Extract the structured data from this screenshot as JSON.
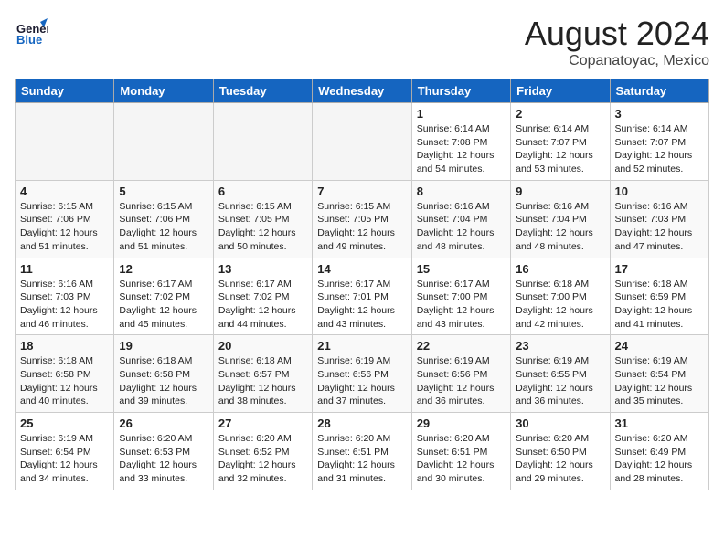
{
  "header": {
    "logo_line1": "General",
    "logo_line2": "Blue",
    "month_year": "August 2024",
    "location": "Copanatoyac, Mexico"
  },
  "weekdays": [
    "Sunday",
    "Monday",
    "Tuesday",
    "Wednesday",
    "Thursday",
    "Friday",
    "Saturday"
  ],
  "weeks": [
    [
      {
        "day": "",
        "info": ""
      },
      {
        "day": "",
        "info": ""
      },
      {
        "day": "",
        "info": ""
      },
      {
        "day": "",
        "info": ""
      },
      {
        "day": "1",
        "info": "Sunrise: 6:14 AM\nSunset: 7:08 PM\nDaylight: 12 hours\nand 54 minutes."
      },
      {
        "day": "2",
        "info": "Sunrise: 6:14 AM\nSunset: 7:07 PM\nDaylight: 12 hours\nand 53 minutes."
      },
      {
        "day": "3",
        "info": "Sunrise: 6:14 AM\nSunset: 7:07 PM\nDaylight: 12 hours\nand 52 minutes."
      }
    ],
    [
      {
        "day": "4",
        "info": "Sunrise: 6:15 AM\nSunset: 7:06 PM\nDaylight: 12 hours\nand 51 minutes."
      },
      {
        "day": "5",
        "info": "Sunrise: 6:15 AM\nSunset: 7:06 PM\nDaylight: 12 hours\nand 51 minutes."
      },
      {
        "day": "6",
        "info": "Sunrise: 6:15 AM\nSunset: 7:05 PM\nDaylight: 12 hours\nand 50 minutes."
      },
      {
        "day": "7",
        "info": "Sunrise: 6:15 AM\nSunset: 7:05 PM\nDaylight: 12 hours\nand 49 minutes."
      },
      {
        "day": "8",
        "info": "Sunrise: 6:16 AM\nSunset: 7:04 PM\nDaylight: 12 hours\nand 48 minutes."
      },
      {
        "day": "9",
        "info": "Sunrise: 6:16 AM\nSunset: 7:04 PM\nDaylight: 12 hours\nand 48 minutes."
      },
      {
        "day": "10",
        "info": "Sunrise: 6:16 AM\nSunset: 7:03 PM\nDaylight: 12 hours\nand 47 minutes."
      }
    ],
    [
      {
        "day": "11",
        "info": "Sunrise: 6:16 AM\nSunset: 7:03 PM\nDaylight: 12 hours\nand 46 minutes."
      },
      {
        "day": "12",
        "info": "Sunrise: 6:17 AM\nSunset: 7:02 PM\nDaylight: 12 hours\nand 45 minutes."
      },
      {
        "day": "13",
        "info": "Sunrise: 6:17 AM\nSunset: 7:02 PM\nDaylight: 12 hours\nand 44 minutes."
      },
      {
        "day": "14",
        "info": "Sunrise: 6:17 AM\nSunset: 7:01 PM\nDaylight: 12 hours\nand 43 minutes."
      },
      {
        "day": "15",
        "info": "Sunrise: 6:17 AM\nSunset: 7:00 PM\nDaylight: 12 hours\nand 43 minutes."
      },
      {
        "day": "16",
        "info": "Sunrise: 6:18 AM\nSunset: 7:00 PM\nDaylight: 12 hours\nand 42 minutes."
      },
      {
        "day": "17",
        "info": "Sunrise: 6:18 AM\nSunset: 6:59 PM\nDaylight: 12 hours\nand 41 minutes."
      }
    ],
    [
      {
        "day": "18",
        "info": "Sunrise: 6:18 AM\nSunset: 6:58 PM\nDaylight: 12 hours\nand 40 minutes."
      },
      {
        "day": "19",
        "info": "Sunrise: 6:18 AM\nSunset: 6:58 PM\nDaylight: 12 hours\nand 39 minutes."
      },
      {
        "day": "20",
        "info": "Sunrise: 6:18 AM\nSunset: 6:57 PM\nDaylight: 12 hours\nand 38 minutes."
      },
      {
        "day": "21",
        "info": "Sunrise: 6:19 AM\nSunset: 6:56 PM\nDaylight: 12 hours\nand 37 minutes."
      },
      {
        "day": "22",
        "info": "Sunrise: 6:19 AM\nSunset: 6:56 PM\nDaylight: 12 hours\nand 36 minutes."
      },
      {
        "day": "23",
        "info": "Sunrise: 6:19 AM\nSunset: 6:55 PM\nDaylight: 12 hours\nand 36 minutes."
      },
      {
        "day": "24",
        "info": "Sunrise: 6:19 AM\nSunset: 6:54 PM\nDaylight: 12 hours\nand 35 minutes."
      }
    ],
    [
      {
        "day": "25",
        "info": "Sunrise: 6:19 AM\nSunset: 6:54 PM\nDaylight: 12 hours\nand 34 minutes."
      },
      {
        "day": "26",
        "info": "Sunrise: 6:20 AM\nSunset: 6:53 PM\nDaylight: 12 hours\nand 33 minutes."
      },
      {
        "day": "27",
        "info": "Sunrise: 6:20 AM\nSunset: 6:52 PM\nDaylight: 12 hours\nand 32 minutes."
      },
      {
        "day": "28",
        "info": "Sunrise: 6:20 AM\nSunset: 6:51 PM\nDaylight: 12 hours\nand 31 minutes."
      },
      {
        "day": "29",
        "info": "Sunrise: 6:20 AM\nSunset: 6:51 PM\nDaylight: 12 hours\nand 30 minutes."
      },
      {
        "day": "30",
        "info": "Sunrise: 6:20 AM\nSunset: 6:50 PM\nDaylight: 12 hours\nand 29 minutes."
      },
      {
        "day": "31",
        "info": "Sunrise: 6:20 AM\nSunset: 6:49 PM\nDaylight: 12 hours\nand 28 minutes."
      }
    ]
  ]
}
